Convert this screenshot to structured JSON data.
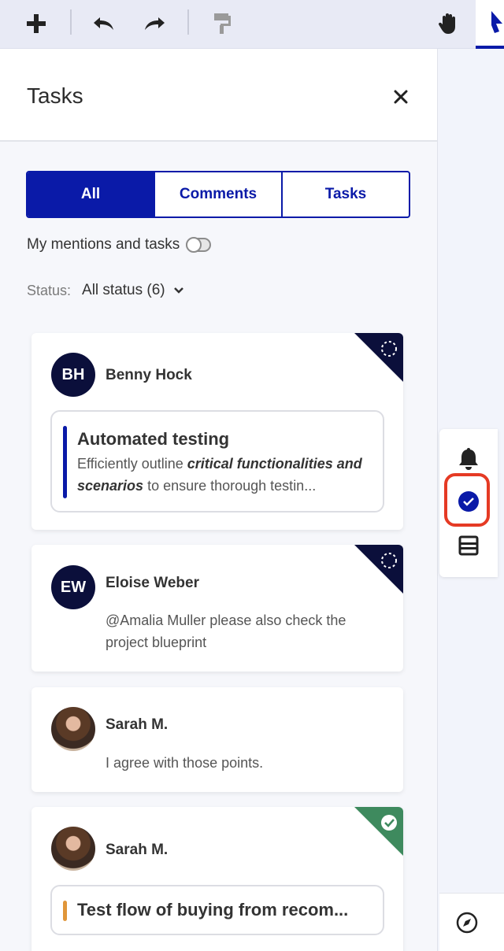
{
  "toolbar": {
    "icons": [
      "plus-icon",
      "undo-icon",
      "redo-icon",
      "format-painter-icon",
      "hand-icon",
      "pointer-icon"
    ]
  },
  "panel": {
    "title": "Tasks",
    "tabs": [
      {
        "label": "All",
        "active": true
      },
      {
        "label": "Comments",
        "active": false
      },
      {
        "label": "Tasks",
        "active": false
      }
    ],
    "mentions_label": "My mentions and tasks",
    "status_label": "Status:",
    "status_value": "All status (6)"
  },
  "cards": [
    {
      "initials": "BH",
      "name": "Benny Hock",
      "task_title": "Automated testing",
      "task_desc_pre": "Efficiently outline ",
      "task_desc_bold": "critical functionalities and scenarios",
      "task_desc_post": " to ensure thorough testin...",
      "corner": "open",
      "bar_color": "#0a1aa8"
    },
    {
      "initials": "EW",
      "name": "Eloise Weber",
      "message": "@Amalia Muller please also check the project blueprint",
      "corner": "open"
    },
    {
      "name": "Sarah M.",
      "message": "I agree with those points."
    },
    {
      "name": "Sarah M.",
      "task_title": "Test flow of buying from recom...",
      "corner": "done",
      "bar_color": "#e0963a"
    }
  ],
  "colors": {
    "accent": "#0a1aa8",
    "dark_corner": "#0b0f3b",
    "done_corner": "#3e8a5e",
    "highlight": "#e53a24"
  }
}
